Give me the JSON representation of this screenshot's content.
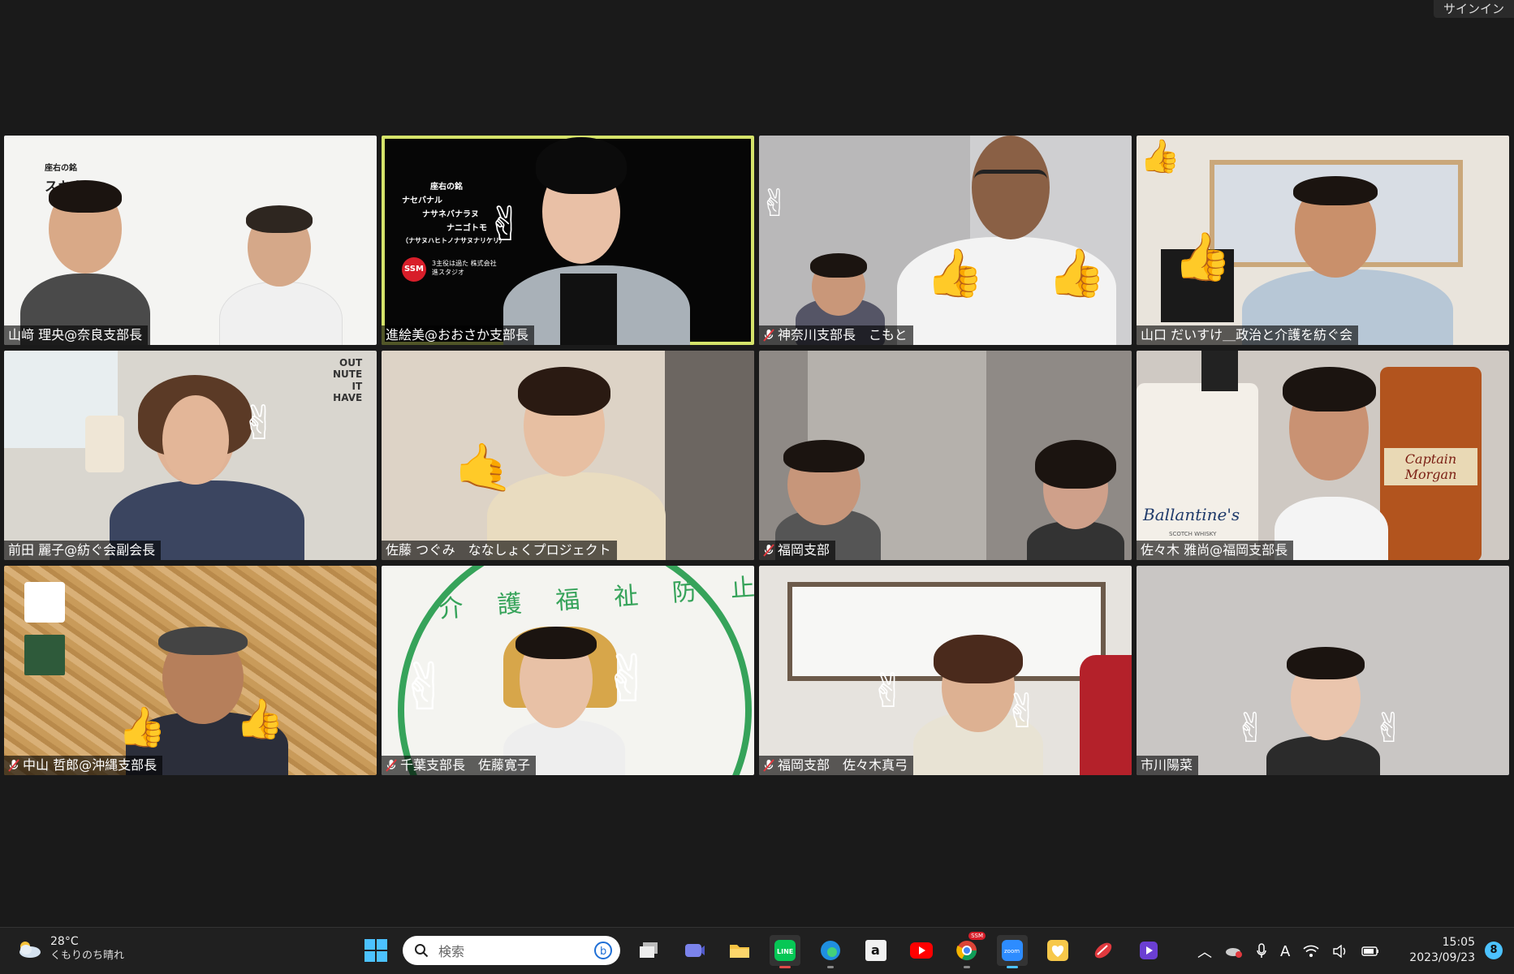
{
  "window": {
    "signin_label": "サインイン"
  },
  "participants": [
    {
      "name": "山﨑 理央@奈良支部長",
      "muted": false,
      "active": false,
      "bg": "#f4f4f2"
    },
    {
      "name": "進絵美@おおさか支部長",
      "muted": false,
      "active": true,
      "bg": "#060606"
    },
    {
      "name": "神奈川支部長　こもと",
      "muted": true,
      "active": false,
      "bg": "#b9b8b9"
    },
    {
      "name": "山口 だいすけ＿政治と介護を紡ぐ会",
      "muted": false,
      "active": false,
      "bg": "#e9e4dc"
    },
    {
      "name": "前田 麗子@紡ぐ会副会長",
      "muted": false,
      "active": false,
      "bg": "#d9d6cf"
    },
    {
      "name": "佐藤 つぐみ　ななしょくプロジェクト",
      "muted": false,
      "active": false,
      "bg": "#ddd3c6"
    },
    {
      "name": "福岡支部",
      "muted": true,
      "active": false,
      "bg": "#8f8a86"
    },
    {
      "name": "佐々木 雅尚@福岡支部長",
      "muted": false,
      "active": false,
      "bg": "#cfc9c3"
    },
    {
      "name": "中山 哲郎@沖縄支部長",
      "muted": true,
      "active": false,
      "bg": "#c99b5a"
    },
    {
      "name": "千葉支部長　佐藤寛子",
      "muted": true,
      "active": false,
      "bg": "#f4f4f0"
    },
    {
      "name": "福岡支部　佐々木真弓",
      "muted": true,
      "active": false,
      "bg": "#e6e3de"
    },
    {
      "name": "市川陽菜",
      "muted": false,
      "active": false,
      "bg": "#c9c6c4"
    }
  ],
  "tile1_overlay": {
    "lines": [
      "座右の銘",
      "スキナ",
      "ス"
    ]
  },
  "tile2_overlay": {
    "lines": [
      "座右の銘",
      "ナセバナル",
      "ナサネバナラヌ",
      "ナニゴトモ",
      "（ナサヌハヒトノナサヌナリケリ）"
    ],
    "badge": "SSM",
    "company": "3主役は過た 株式会社進スタジオ"
  },
  "tile4_misc": {},
  "tile5_overlay": {
    "lines": [
      "OUT",
      "NUTE",
      "IT",
      "HAVE"
    ]
  },
  "tile8_bottles": {
    "left_label": "Ballantine's",
    "left_sub": "SCOTCH WHISKY",
    "right_label": "Captain Morgan"
  },
  "tile10_overlay": {
    "chars": [
      "介",
      "護",
      "福",
      "祉",
      "防",
      "止"
    ]
  },
  "taskbar": {
    "weather_temp": "28°C",
    "weather_desc": "くもりのち晴れ",
    "search_placeholder": "検索",
    "apps": [
      "task-view-icon",
      "teams-icon",
      "file-explorer-icon",
      "line-icon",
      "edge-icon",
      "amazon-icon",
      "youtube-icon",
      "chrome-icon",
      "zoom-icon",
      "app-heart-icon",
      "app-red-icon",
      "app-purple-icon"
    ],
    "chrome_badge": "SSM",
    "clock_time": "15:05",
    "clock_date": "2023/09/23",
    "notification_count": "8",
    "ime_indicator": "A"
  }
}
